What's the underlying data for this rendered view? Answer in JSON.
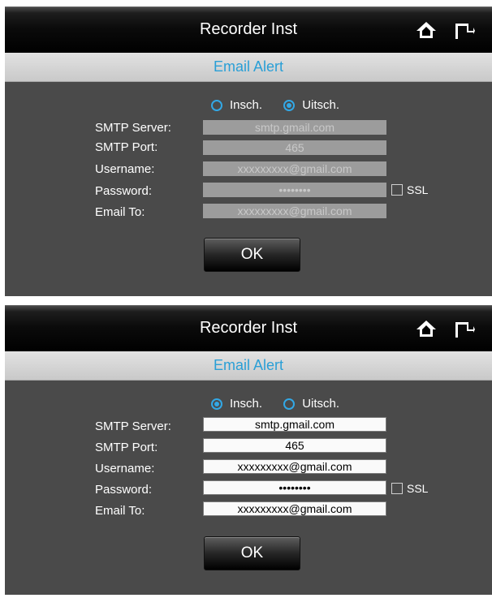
{
  "screens": [
    {
      "title": "Recorder Inst",
      "subtitle": "Email Alert",
      "radio_on": "Insch.",
      "radio_off": "Uitsch.",
      "selected": "Uitsch.",
      "labels": {
        "server": "SMTP Server:",
        "port": "SMTP Port:",
        "username": "Username:",
        "password": "Password:",
        "email_to": "Email To:"
      },
      "values": {
        "server": "smtp.gmail.com",
        "port": "465",
        "username": "xxxxxxxxx@gmail.com",
        "password": "••••••••",
        "email_to": "xxxxxxxxx@gmail.com"
      },
      "ssl_label": "SSL",
      "ok_label": "OK",
      "state": "disabled"
    },
    {
      "title": "Recorder Inst",
      "subtitle": "Email Alert",
      "radio_on": "Insch.",
      "radio_off": "Uitsch.",
      "selected": "Insch.",
      "labels": {
        "server": "SMTP Server:",
        "port": "SMTP Port:",
        "username": "Username:",
        "password": "Password:",
        "email_to": "Email To:"
      },
      "values": {
        "server": "smtp.gmail.com",
        "port": "465",
        "username": "xxxxxxxxx@gmail.com",
        "password": "••••••••",
        "email_to": "xxxxxxxxx@gmail.com"
      },
      "ssl_label": "SSL",
      "ok_label": "OK",
      "state": "enabled"
    }
  ],
  "icons": {
    "home": "home-icon",
    "exit": "exit-icon"
  },
  "colors": {
    "accent": "#2a9fd6",
    "radio": "#32a8e6",
    "panel_bg": "#4a4a4a"
  }
}
